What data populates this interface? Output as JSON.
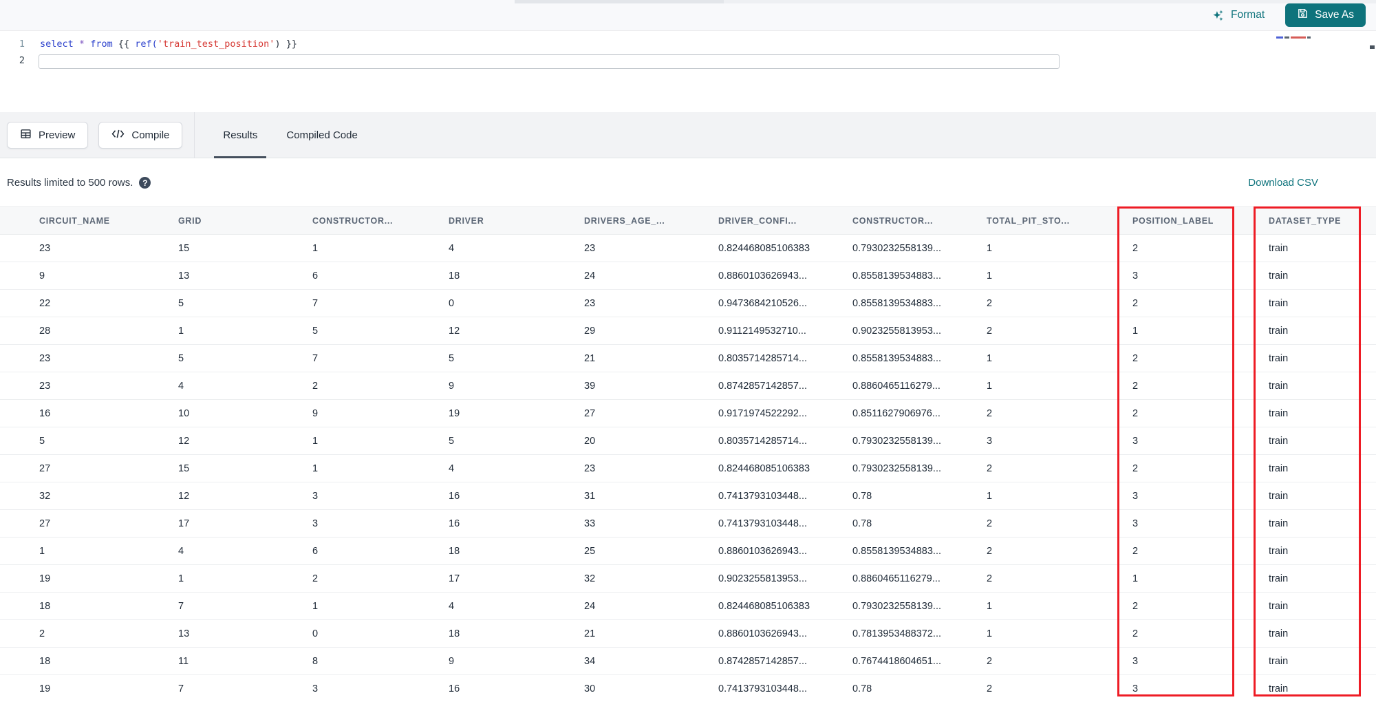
{
  "top_bar": {
    "format_label": "Format",
    "save_as_label": "Save As"
  },
  "editor": {
    "lines": [
      {
        "number": "1",
        "active": false,
        "tokens": [
          {
            "text": "select",
            "type": "keyword"
          },
          {
            "text": " ",
            "type": "plain"
          },
          {
            "text": "*",
            "type": "operator"
          },
          {
            "text": " ",
            "type": "plain"
          },
          {
            "text": "from",
            "type": "keyword"
          },
          {
            "text": " {{ ",
            "type": "plain"
          },
          {
            "text": "ref(",
            "type": "function"
          },
          {
            "text": "'train_test_position'",
            "type": "string"
          },
          {
            "text": ")",
            "type": "plain"
          },
          {
            "text": " }}",
            "type": "plain"
          }
        ]
      },
      {
        "number": "2",
        "active": true,
        "tokens": []
      }
    ]
  },
  "action_bar": {
    "preview_label": "Preview",
    "compile_label": "Compile",
    "tabs": [
      {
        "label": "Results",
        "active": true
      },
      {
        "label": "Compiled Code",
        "active": false
      }
    ]
  },
  "results_bar": {
    "limit_message": "Results limited to 500 rows.",
    "help_glyph": "?",
    "download_label": "Download CSV"
  },
  "table": {
    "columns": [
      "CIRCUIT_NAME",
      "GRID",
      "CONSTRUCTOR...",
      "DRIVER",
      "DRIVERS_AGE_...",
      "DRIVER_CONFI...",
      "CONSTRUCTOR...",
      "TOTAL_PIT_STO...",
      "POSITION_LABEL",
      "DATASET_TYPE"
    ],
    "rows": [
      [
        "23",
        "15",
        "1",
        "4",
        "23",
        "0.824468085106383",
        "0.7930232558139...",
        "1",
        "2",
        "train"
      ],
      [
        "9",
        "13",
        "6",
        "18",
        "24",
        "0.8860103626943...",
        "0.8558139534883...",
        "1",
        "3",
        "train"
      ],
      [
        "22",
        "5",
        "7",
        "0",
        "23",
        "0.9473684210526...",
        "0.8558139534883...",
        "2",
        "2",
        "train"
      ],
      [
        "28",
        "1",
        "5",
        "12",
        "29",
        "0.9112149532710...",
        "0.9023255813953...",
        "2",
        "1",
        "train"
      ],
      [
        "23",
        "5",
        "7",
        "5",
        "21",
        "0.8035714285714...",
        "0.8558139534883...",
        "1",
        "2",
        "train"
      ],
      [
        "23",
        "4",
        "2",
        "9",
        "39",
        "0.8742857142857...",
        "0.8860465116279...",
        "1",
        "2",
        "train"
      ],
      [
        "16",
        "10",
        "9",
        "19",
        "27",
        "0.9171974522292...",
        "0.8511627906976...",
        "2",
        "2",
        "train"
      ],
      [
        "5",
        "12",
        "1",
        "5",
        "20",
        "0.8035714285714...",
        "0.7930232558139...",
        "3",
        "3",
        "train"
      ],
      [
        "27",
        "15",
        "1",
        "4",
        "23",
        "0.824468085106383",
        "0.7930232558139...",
        "2",
        "2",
        "train"
      ],
      [
        "32",
        "12",
        "3",
        "16",
        "31",
        "0.7413793103448...",
        "0.78",
        "1",
        "3",
        "train"
      ],
      [
        "27",
        "17",
        "3",
        "16",
        "33",
        "0.7413793103448...",
        "0.78",
        "2",
        "3",
        "train"
      ],
      [
        "1",
        "4",
        "6",
        "18",
        "25",
        "0.8860103626943...",
        "0.8558139534883...",
        "2",
        "2",
        "train"
      ],
      [
        "19",
        "1",
        "2",
        "17",
        "32",
        "0.9023255813953...",
        "0.8860465116279...",
        "2",
        "1",
        "train"
      ],
      [
        "18",
        "7",
        "1",
        "4",
        "24",
        "0.824468085106383",
        "0.7930232558139...",
        "1",
        "2",
        "train"
      ],
      [
        "2",
        "13",
        "0",
        "18",
        "21",
        "0.8860103626943...",
        "0.7813953488372...",
        "1",
        "2",
        "train"
      ],
      [
        "18",
        "11",
        "8",
        "9",
        "34",
        "0.8742857142857...",
        "0.7674418604651...",
        "2",
        "3",
        "train"
      ],
      [
        "19",
        "7",
        "3",
        "16",
        "30",
        "0.7413793103448...",
        "0.78",
        "2",
        "3",
        "train"
      ]
    ],
    "highlighted_columns": [
      "POSITION_LABEL",
      "DATASET_TYPE"
    ]
  },
  "icons": {
    "format": "sparkles-icon",
    "save_as": "floppy-disk-icon",
    "preview": "table-grid-icon",
    "compile": "code-brackets-icon",
    "help": "question-circle-icon"
  },
  "colors": {
    "accent": "#0e737c",
    "highlight_box": "#ee1c25",
    "tab_underline": "#454f5d"
  }
}
